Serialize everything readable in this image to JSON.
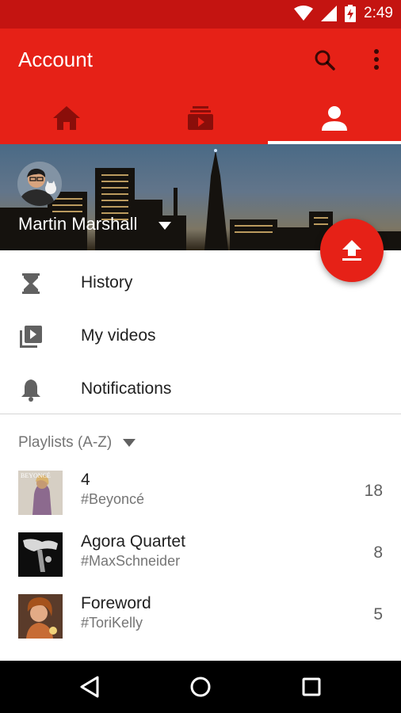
{
  "status_bar": {
    "time": "2:49"
  },
  "app_bar": {
    "title": "Account"
  },
  "tabs": [
    {
      "name": "home"
    },
    {
      "name": "subscriptions"
    },
    {
      "name": "account",
      "selected": true
    }
  ],
  "profile": {
    "name": "Martin Marshall"
  },
  "menu": [
    {
      "label": "History",
      "icon": "hourglass-icon"
    },
    {
      "label": "My videos",
      "icon": "video-library-icon"
    },
    {
      "label": "Notifications",
      "icon": "bell-icon"
    }
  ],
  "playlists": {
    "header": "Playlists (A-Z)",
    "items": [
      {
        "title": "4",
        "subtitle": "#Beyoncé",
        "count": "18",
        "thumb_text": "BEYONCÉ"
      },
      {
        "title": "Agora Quartet",
        "subtitle": "#MaxSchneider",
        "count": "8"
      },
      {
        "title": "Foreword",
        "subtitle": "#ToriKelly",
        "count": "5"
      }
    ]
  },
  "colors": {
    "primary": "#e62117",
    "status_bar": "#c41411",
    "text_primary": "#212121",
    "text_secondary": "#757575"
  }
}
